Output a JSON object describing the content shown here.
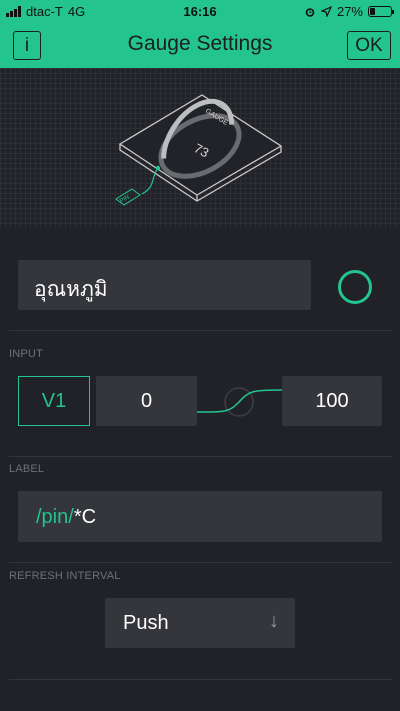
{
  "status_bar": {
    "carrier": "dtac-T",
    "network": "4G",
    "time": "16:16",
    "battery": "27%",
    "battery_level": 0.27
  },
  "nav": {
    "info_label": "i",
    "title": "Gauge Settings",
    "ok_label": "OK"
  },
  "preview": {
    "widget_label": "GAUGE",
    "value": "73",
    "pin_label": "PIN"
  },
  "widget_name": "อุณหภูมิ",
  "colors": {
    "accent": "#23c48e",
    "background": "#212227",
    "field": "#34363c",
    "section_label": "#6f7077"
  },
  "input": {
    "section_label": "INPUT",
    "pin": "V1",
    "min": "0",
    "max": "100"
  },
  "label": {
    "section_label": "LABEL",
    "prefix": "/pin/",
    "suffix": "*C"
  },
  "refresh": {
    "section_label": "REFRESH INTERVAL",
    "value": "Push"
  }
}
